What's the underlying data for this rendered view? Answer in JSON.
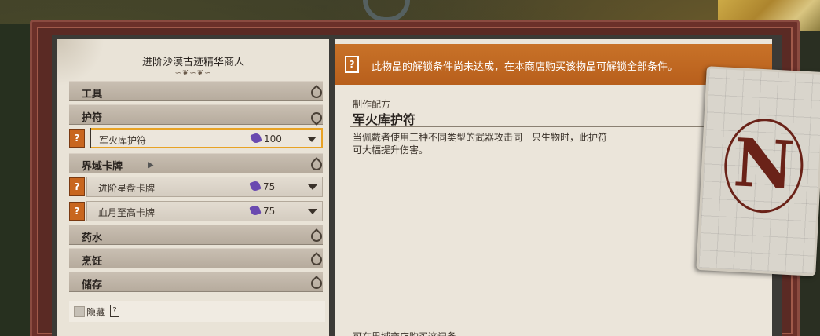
{
  "merchant": {
    "title": "进阶沙漠古迹精华商人",
    "flourish": "∽❦∽❦∽"
  },
  "categories": [
    {
      "label": "工具",
      "expanded": false
    },
    {
      "label": "护符",
      "expanded": true
    },
    {
      "label": "界域卡牌",
      "expanded": true
    },
    {
      "label": "药水",
      "expanded": false
    },
    {
      "label": "烹饪",
      "expanded": false
    },
    {
      "label": "储存",
      "expanded": false
    }
  ],
  "items": [
    {
      "name": "军火库护符",
      "price": "100",
      "icon": "?",
      "selected": true
    },
    {
      "name": "进阶星盘卡牌",
      "price": "75",
      "icon": "?"
    },
    {
      "name": "血月至高卡牌",
      "price": "75",
      "icon": "?"
    }
  ],
  "hide": {
    "label": "隐藏",
    "icon": "?"
  },
  "banner": {
    "icon": "?",
    "text": "此物品的解锁条件尚未达成，在本商店购买该物品可解锁全部条件。"
  },
  "detail": {
    "recipe_label": "制作配方",
    "title": "军火库护符",
    "description_line1": "当佩戴者使用三种不同类型的武器攻击同一只生物时，此护符",
    "description_line2": "可大幅提升伤害。",
    "footer_cut": "可在界域商店购买这记备"
  },
  "card": {
    "letter": "N"
  },
  "colors": {
    "accent": "#c8661f",
    "banner": "#c87228",
    "frame": "#5a2a24",
    "selected_border": "#e8a224"
  }
}
